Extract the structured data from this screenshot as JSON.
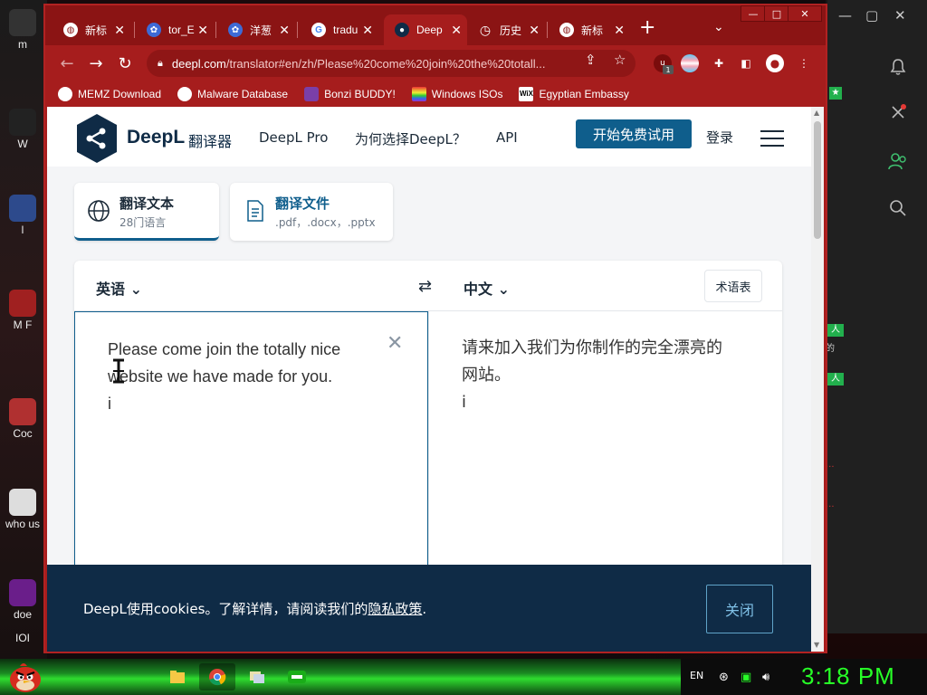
{
  "desktop": {
    "left_icons": [
      {
        "label": "m"
      },
      {
        "label": "W"
      },
      {
        "label": "l"
      },
      {
        "label": "M F"
      },
      {
        "label": "Coc"
      },
      {
        "label": "who us"
      },
      {
        "label": "doe"
      },
      {
        "label": "IOI"
      }
    ],
    "side_badges": [
      "人",
      "人"
    ],
    "side_texts": [
      "的",
      "...",
      "..."
    ]
  },
  "browser": {
    "tabs": [
      {
        "label": "新标",
        "icon": "globe-icon"
      },
      {
        "label": "tor_E",
        "icon": "baidu-icon"
      },
      {
        "label": "洋葱",
        "icon": "baidu-icon"
      },
      {
        "label": "tradu",
        "icon": "google-icon"
      },
      {
        "label": "Deep",
        "icon": "deepl-icon",
        "active": true
      },
      {
        "label": "历史",
        "icon": "history-icon"
      },
      {
        "label": "新标",
        "icon": "globe-icon"
      }
    ],
    "url_domain": "deepl.com",
    "url_path": "/translator#en/zh/Please%20come%20join%20the%20totall...",
    "extension_badge": "1",
    "bookmarks": [
      {
        "label": "MEMZ Download",
        "icon": "globe-icon"
      },
      {
        "label": "Malware Database",
        "icon": "globe-icon"
      },
      {
        "label": "Bonzi BUDDY!",
        "icon": "bonzi-icon"
      },
      {
        "label": "Windows ISOs",
        "icon": "rainbow-flag-icon"
      },
      {
        "label": "Egyptian Embassy",
        "icon": "wix-icon"
      }
    ]
  },
  "deepl": {
    "logo_text": "DeepL",
    "logo_sub": "翻译器",
    "nav": {
      "pro": "DeepL Pro",
      "why": "为何选择DeepL？",
      "api": "API"
    },
    "cta": "开始免费试用",
    "login": "登录",
    "mode_text": {
      "title": "翻译文本",
      "subtitle": "28门语言"
    },
    "mode_doc": {
      "title": "翻译文件",
      "subtitle": ".pdf，.docx，.pptx"
    },
    "source_lang": "英语",
    "target_lang": "中文",
    "glossary": "术语表",
    "source_text": "Please come join the totally nice website we have made for you.",
    "source_tail": "i",
    "target_text": "请来加入我们为你制作的完全漂亮的网站。",
    "target_tail": "i",
    "cookie": {
      "text_before": "DeepL使用cookies。了解详情，请阅读我们的",
      "link": "隐私政策",
      "text_after": ".",
      "close": "关闭"
    }
  },
  "taskbar": {
    "lang": "EN",
    "clock": "3:18 PM"
  },
  "colors": {
    "browser_red": "#a61d1d",
    "deepl_navy": "#0f2b46",
    "deepl_blue": "#0f5e8c",
    "clock_green": "#27ff27"
  }
}
